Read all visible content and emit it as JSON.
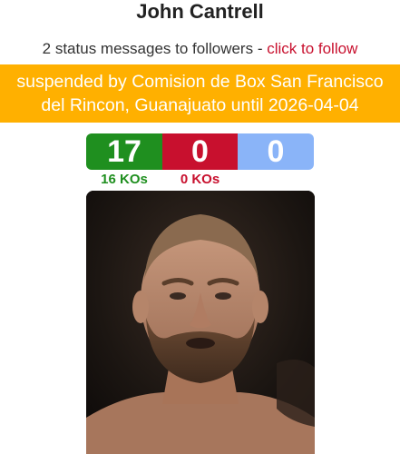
{
  "fighter": {
    "name": "John Cantrell"
  },
  "status": {
    "text": "2 status messages to followers - ",
    "follow_link": "click to follow"
  },
  "suspension": {
    "line1": "suspended by Comision de Box San Francisco",
    "line2": "del Rincon, Guanajuato until 2026-04-04"
  },
  "record": {
    "wins": "17",
    "losses": "0",
    "draws": "0",
    "wins_kos": "16 KOs",
    "losses_kos": "0 KOs"
  },
  "colors": {
    "wins": "#1f8f1f",
    "losses": "#c8102e",
    "draws": "#8ab4f8",
    "banner": "#ffb000",
    "link": "#c8102e"
  },
  "photo": {
    "icon": "fighter-portrait"
  }
}
